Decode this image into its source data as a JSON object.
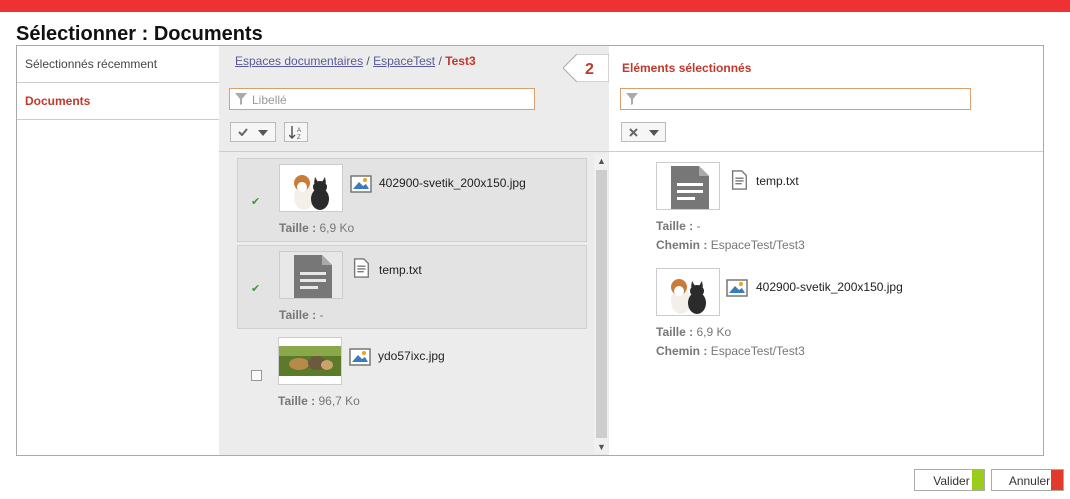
{
  "dialog": {
    "title": "Sélectionner : Documents"
  },
  "sidebar": {
    "items": [
      {
        "label": "Sélectionnés récemment",
        "active": false
      },
      {
        "label": "Documents",
        "active": true
      }
    ]
  },
  "breadcrumb": {
    "parts": [
      "Espaces documentaires",
      "EspaceTest"
    ],
    "separator": "/",
    "current": "Test3"
  },
  "left_filter": {
    "placeholder": "Libellé",
    "value": ""
  },
  "selection_count": "2",
  "right_title": "Eléments sélectionnés",
  "right_filter": {
    "placeholder": "",
    "value": ""
  },
  "labels": {
    "size": "Taille :",
    "path": "Chemin :"
  },
  "files": [
    {
      "name": "402900-svetik_200x150.jpg",
      "size": "6,9 Ko",
      "selected": true,
      "thumb": "dog-cat"
    },
    {
      "name": "temp.txt",
      "size": "-",
      "selected": true,
      "thumb": "document"
    },
    {
      "name": "ydo57ixc.jpg",
      "size": "96,7 Ko",
      "selected": false,
      "thumb": "animals-grass"
    }
  ],
  "selected_files": [
    {
      "name": "temp.txt",
      "size": "-",
      "path": "EspaceTest/Test3",
      "thumb": "document"
    },
    {
      "name": "402900-svetik_200x150.jpg",
      "size": "6,9 Ko",
      "path": "EspaceTest/Test3",
      "thumb": "dog-cat"
    }
  ],
  "buttons": {
    "validate": "Valider",
    "cancel": "Annuler"
  },
  "colors": {
    "accent": "#c0392b",
    "topbar": "#ee3234",
    "validate": "#9acd1a",
    "cancel": "#e03b2b"
  }
}
